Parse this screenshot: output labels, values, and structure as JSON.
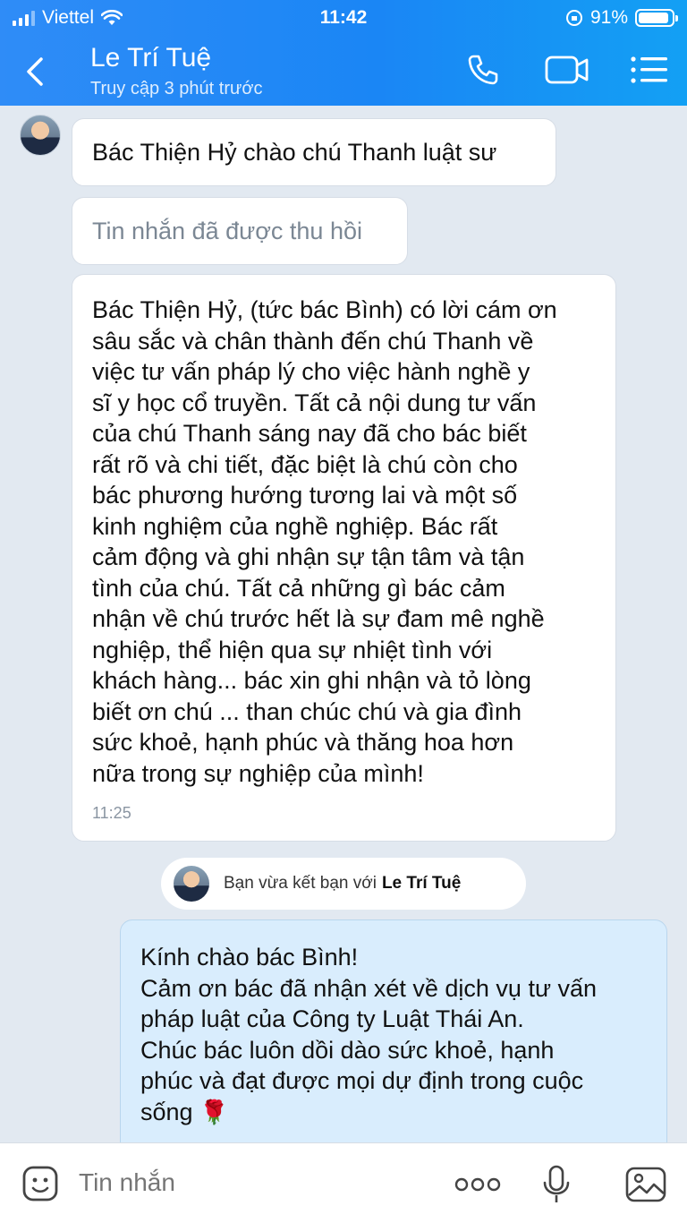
{
  "status_bar": {
    "carrier": "Viettel",
    "time": "11:42",
    "battery": "91%",
    "battery_level": 0.91
  },
  "header": {
    "name": "Le Trí Tuệ",
    "status": "Truy cập 3 phút trước"
  },
  "messages": [
    {
      "text": "Bác Thiện Hỷ chào chú Thanh luật sư"
    },
    {
      "text": "Tin nhắn đã được thu hồi"
    },
    {
      "text": "Bác Thiện Hỷ, (tức bác Bình) có lời cám ơn\nsâu sắc và chân thành đến chú Thanh về\nviệc tư vấn pháp lý cho việc hành nghề y\nsĩ y học cổ truyền. Tất cả nội dung tư vấn\ncủa chú Thanh sáng nay đã cho bác biết\nrất rõ và chi tiết, đặc biệt là chú còn cho\nbác phương hướng tương lai và một số\nkinh nghiệm của nghề nghiệp. Bác rất\ncảm động và ghi nhận sự tận tâm và tận\ntình của chú. Tất cả những gì bác cảm\nnhận về chú trước hết là sự đam mê nghề\nnghiệp, thể hiện qua sự nhiệt tình với\nkhách hàng... bác xin ghi nhận và tỏ lòng\nbiết ơn chú ... than chúc chú và gia đình\nsức khoẻ, hạnh phúc và thăng hoa hơn\nnữa trong sự nghiệp của mình!",
      "time": "11:25"
    }
  ],
  "notice": {
    "text": "Bạn vừa kết bạn với",
    "name": "Le Trí Tuệ"
  },
  "reply": {
    "text": "Kính chào bác Bình!\nCảm ơn bác đã nhận xét về dịch vụ tư vấn\npháp luật của Công ty Luật Thái An.\nChúc bác luôn dồi dào sức khoẻ, hạnh\nphúc và đạt được mọi dự định trong cuộc\nsống",
    "emoji": "🌹"
  },
  "input": {
    "placeholder": "Tin nhắn"
  },
  "icons": {
    "back": "chevron-left-icon",
    "call": "phone-icon",
    "video": "video-camera-icon",
    "menu": "list-menu-icon",
    "emoji": "sticker-icon",
    "more": "more-dots-icon",
    "mic": "microphone-icon",
    "image": "image-icon"
  },
  "colors": {
    "header": "#1a86f5",
    "background": "#e2e9f1",
    "reply_bubble": "#d9edfd",
    "recalled_text": "#7b8794"
  }
}
